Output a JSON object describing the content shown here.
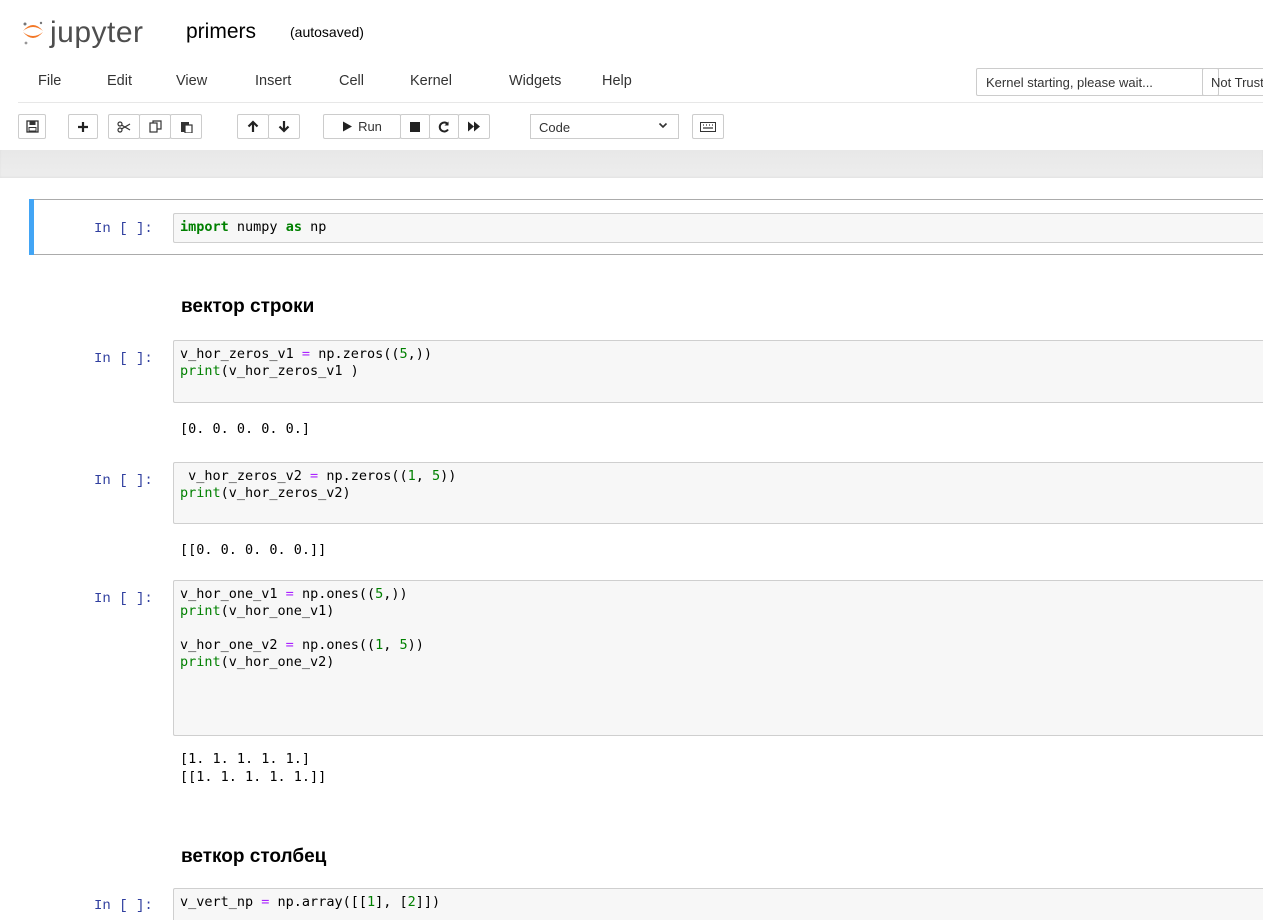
{
  "header": {
    "logo_text": "jupyter",
    "notebook_name": "primers",
    "autosave": "(autosaved)"
  },
  "menu": {
    "items": [
      "File",
      "Edit",
      "View",
      "Insert",
      "Cell",
      "Kernel",
      "Widgets",
      "Help"
    ],
    "kernel_status": "Kernel starting, please wait...",
    "trusted": "Not Trusted"
  },
  "toolbar": {
    "run_label": "Run",
    "cell_type": "Code",
    "icons": [
      "save-icon",
      "plus-icon",
      "cut-icon",
      "copy-icon",
      "paste-icon",
      "arrow-up-icon",
      "arrow-down-icon",
      "run-icon",
      "stop-icon",
      "restart-icon",
      "fast-forward-icon",
      "keyboard-icon"
    ]
  },
  "cells": {
    "c1": {
      "prompt": "In [ ]:"
    },
    "h1": {
      "text": "вектор строки"
    },
    "c2": {
      "prompt": "In [ ]:",
      "output": "[0. 0. 0. 0. 0.]"
    },
    "c3": {
      "prompt": "In [ ]:",
      "output": "[[0. 0. 0. 0. 0.]]"
    },
    "c4": {
      "prompt": "In [ ]:",
      "output1": "[1. 1. 1. 1. 1.]",
      "output2": "[[1. 1. 1. 1. 1.]]"
    },
    "h2": {
      "text": "веткор столбец"
    },
    "c5": {
      "prompt": "In [ ]:"
    }
  },
  "code": {
    "c1_l1": "import numpy as np",
    "c2_l1": "v_hor_zeros_v1 = np.zeros((5,))",
    "c2_l2": "print(v_hor_zeros_v1 )",
    "c3_l1": " v_hor_zeros_v2 = np.zeros((1, 5))",
    "c3_l2": "print(v_hor_zeros_v2)",
    "c4_l1": "v_hor_one_v1 = np.ones((5,))",
    "c4_l2": "print(v_hor_one_v1)",
    "c4_l3": "v_hor_one_v2 = np.ones((1, 5))",
    "c4_l4": "print(v_hor_one_v2)",
    "c5_l1": "v_vert_np = np.array([[1], [2]])"
  }
}
